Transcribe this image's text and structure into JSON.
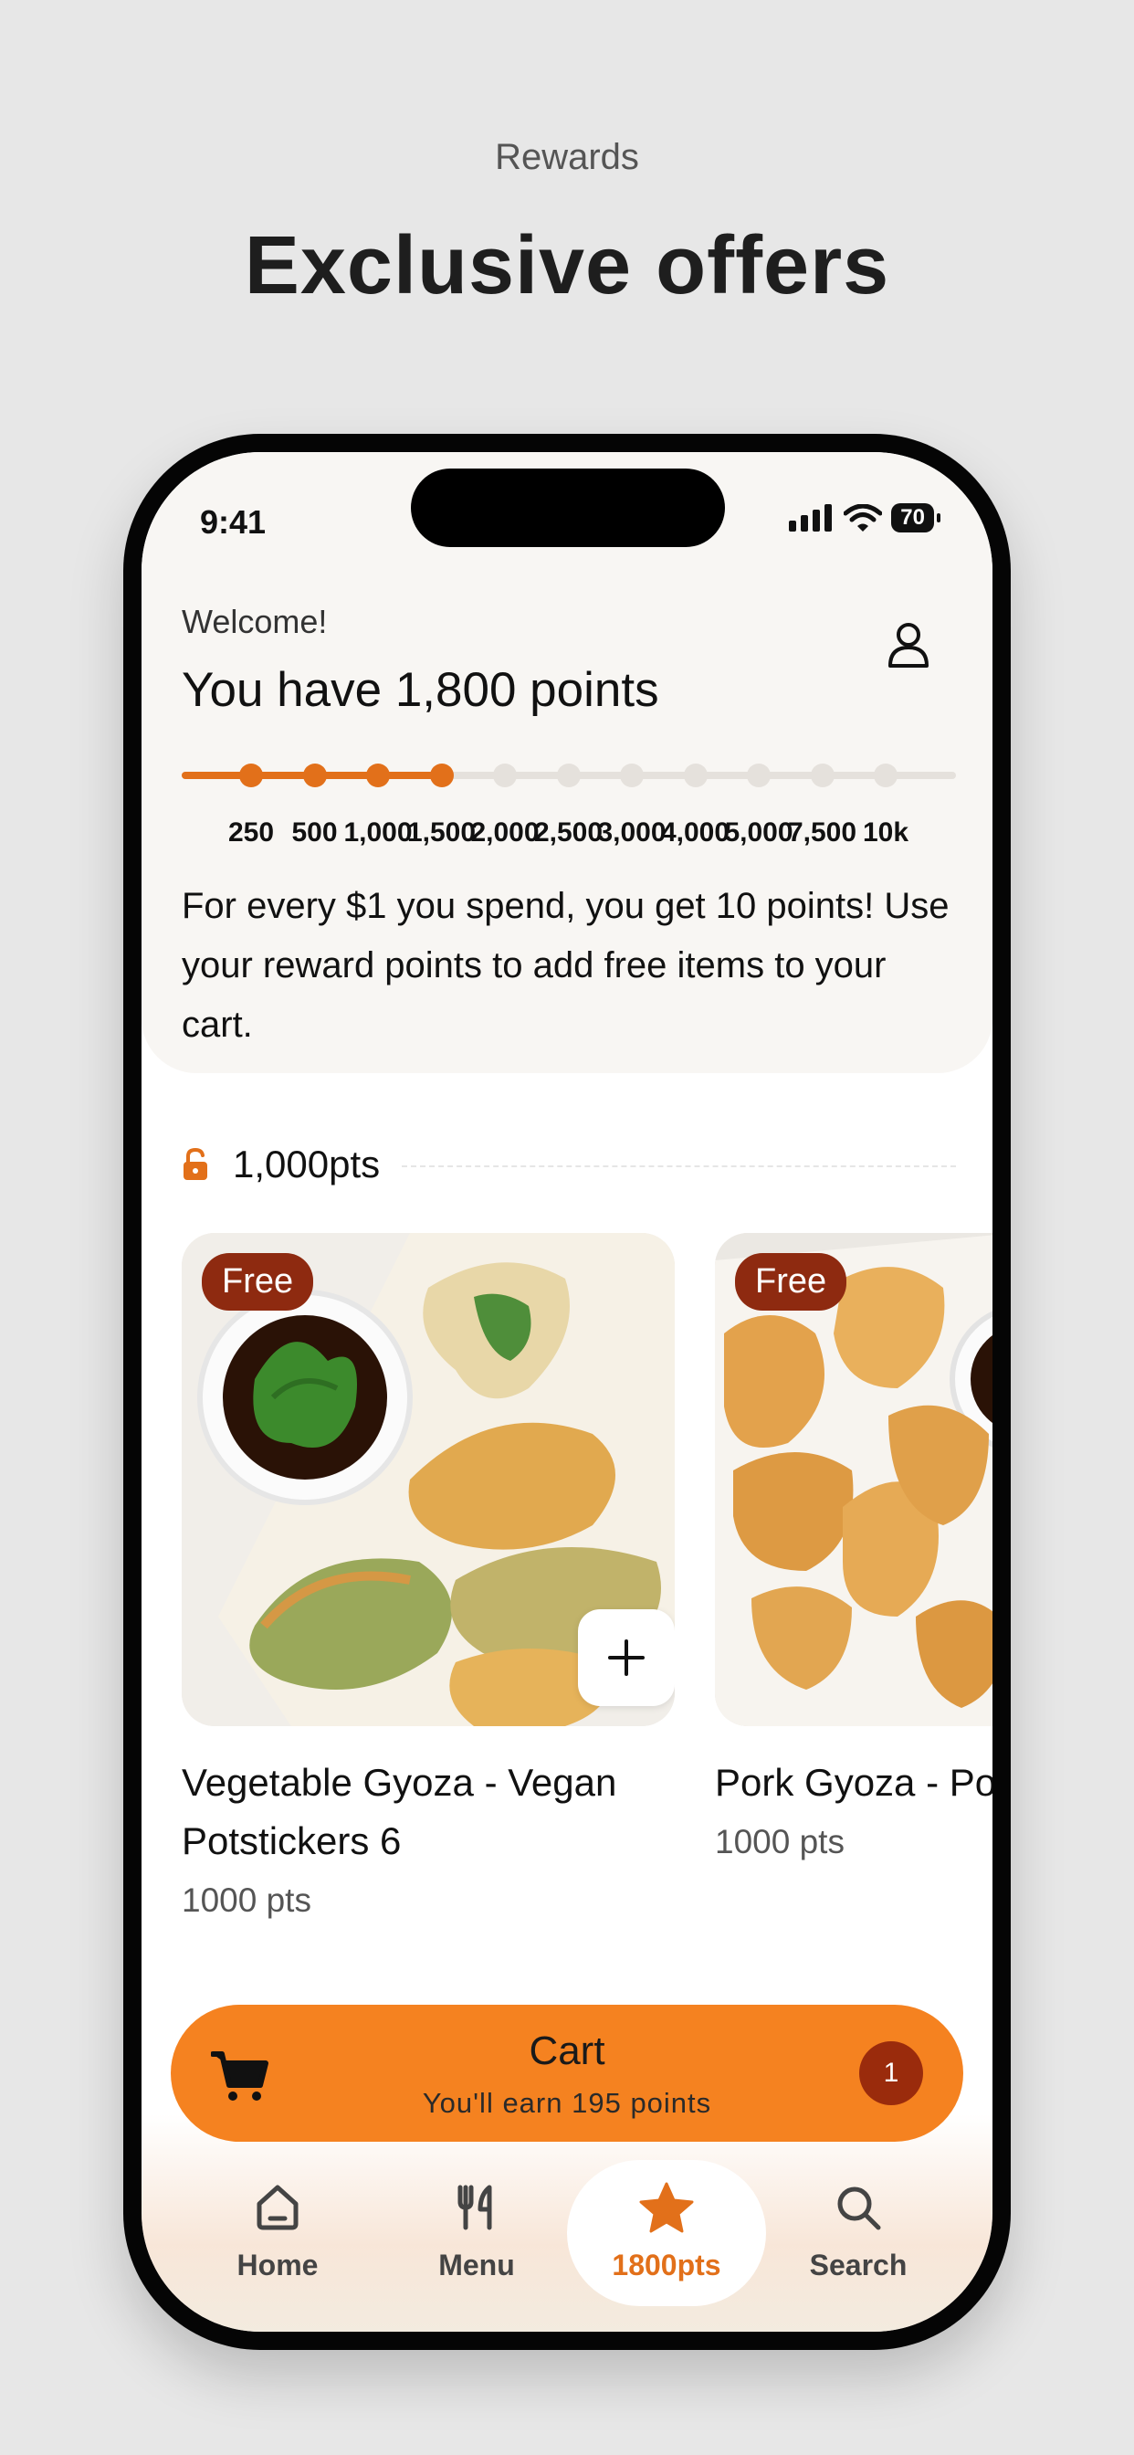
{
  "marketing": {
    "subtitle": "Rewards",
    "title": "Exclusive offers"
  },
  "status_bar": {
    "time": "9:41",
    "battery": "70"
  },
  "header": {
    "welcome": "Welcome!",
    "points_title": "You have 1,800 points",
    "info": "For every $1 you spend, you get 10 points! Use your reward points to add free items to your cart."
  },
  "progress": {
    "current_points": 1800,
    "ticks": [
      "250",
      "500",
      "1,000",
      "1,500",
      "2,000",
      "2,500",
      "3,000",
      "4,000",
      "5,000",
      "7,500",
      "10k"
    ],
    "reached": 4
  },
  "tier": {
    "label": "1,000pts"
  },
  "items": [
    {
      "badge": "Free",
      "name": "Vegetable Gyoza - Vegan Potstickers 6",
      "points": "1000 pts"
    },
    {
      "badge": "Free",
      "name": "Pork Gyoza - Po",
      "points": "1000 pts"
    }
  ],
  "cart": {
    "title": "Cart",
    "subtitle": "You'll earn 195 points",
    "count": "1"
  },
  "tabs": [
    {
      "label": "Home",
      "icon": "home-icon"
    },
    {
      "label": "Menu",
      "icon": "menu-utensils-icon"
    },
    {
      "label": "1800pts",
      "icon": "star-icon"
    },
    {
      "label": "Search",
      "icon": "search-icon"
    }
  ],
  "colors": {
    "accent": "#e2701a",
    "cart": "#f58220",
    "badge": "#8e2a10"
  }
}
